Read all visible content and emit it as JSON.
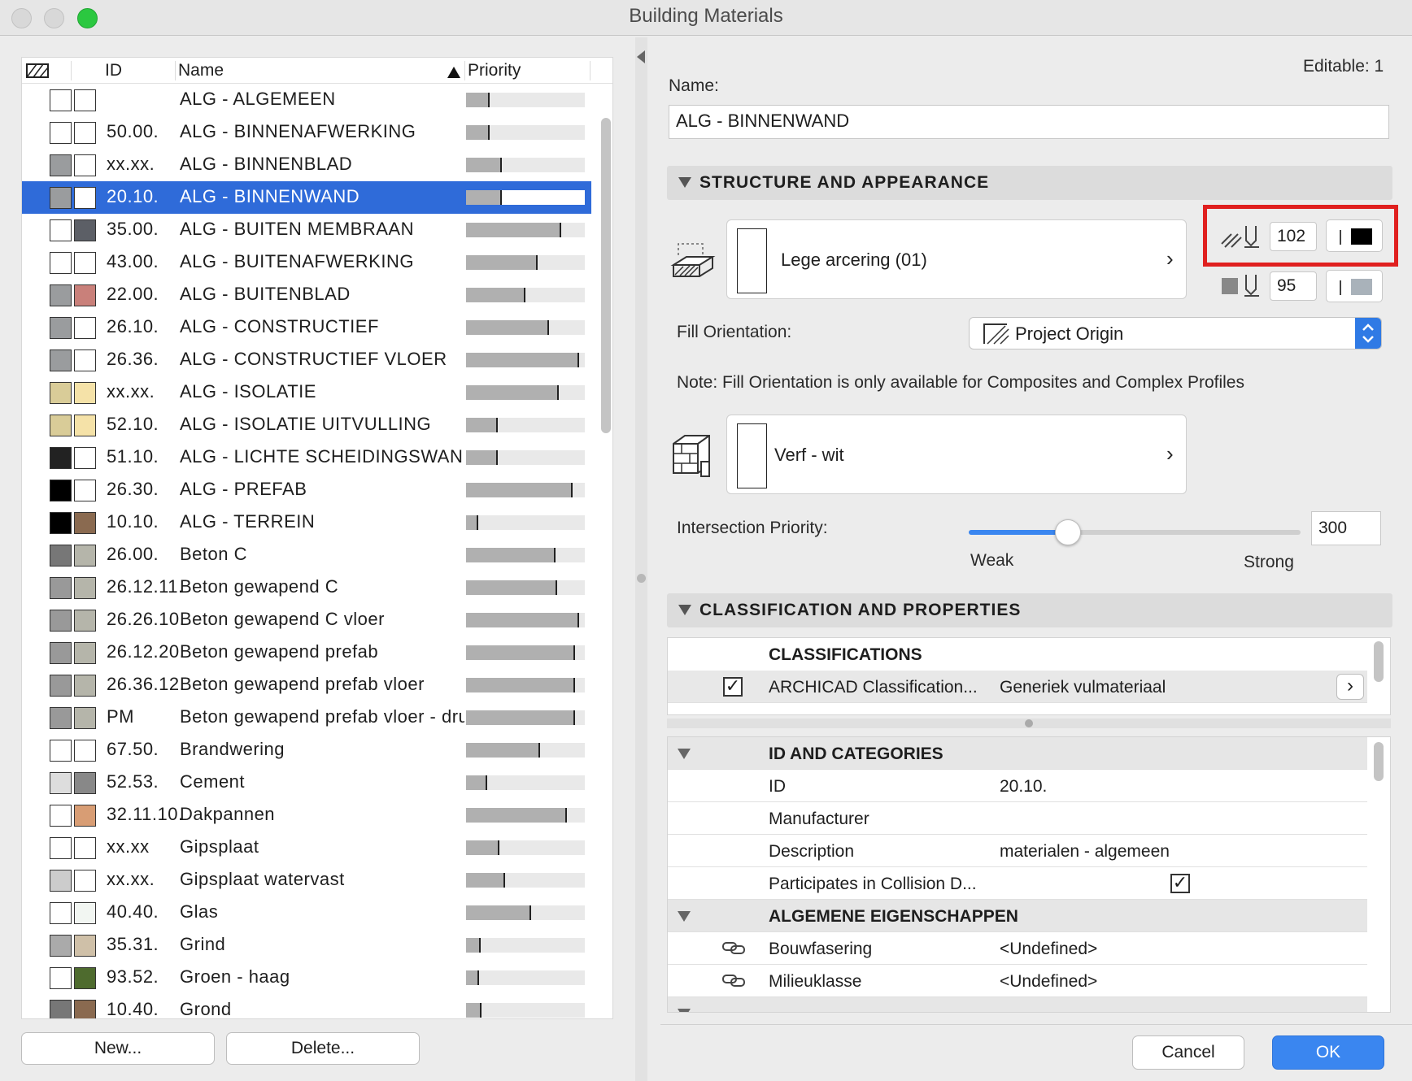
{
  "window": {
    "title": "Building Materials"
  },
  "list": {
    "columns": {
      "id": "ID",
      "name": "Name",
      "priority": "Priority"
    },
    "rows": [
      {
        "id": "",
        "name": "ALG - ALGEMEEN",
        "priority": 0.2,
        "fill": "#ffffff",
        "color": "#ffffff"
      },
      {
        "id": "50.00.",
        "name": "ALG - BINNENAFWERKING",
        "priority": 0.2,
        "fill": "#ffffff",
        "color": "#ffffff"
      },
      {
        "id": "xx.xx.",
        "name": "ALG - BINNENBLAD",
        "priority": 0.3,
        "fill": "#9a9c9e",
        "color": "#ffffff"
      },
      {
        "id": "20.10.",
        "name": "ALG - BINNENWAND",
        "priority": 0.3,
        "fill": "#9a9c9e",
        "color": "#ffffff",
        "selected": true
      },
      {
        "id": "35.00.",
        "name": "ALG - BUITEN MEMBRAAN",
        "priority": 0.8,
        "fill": "#ffffff",
        "color": "#5c5f66"
      },
      {
        "id": "43.00.",
        "name": "ALG - BUITENAFWERKING",
        "priority": 0.6,
        "fill": "#ffffff",
        "color": "#ffffff"
      },
      {
        "id": "22.00.",
        "name": "ALG - BUITENBLAD",
        "priority": 0.5,
        "fill": "#9a9c9e",
        "color": "#c9807a"
      },
      {
        "id": "26.10.",
        "name": "ALG - CONSTRUCTIEF",
        "priority": 0.7,
        "fill": "#9a9c9e",
        "color": "#ffffff"
      },
      {
        "id": "26.36.",
        "name": "ALG - CONSTRUCTIEF VLOER",
        "priority": 0.95,
        "fill": "#9a9c9e",
        "color": "#ffffff"
      },
      {
        "id": "xx.xx.",
        "name": "ALG - ISOLATIE",
        "priority": 0.78,
        "fill": "#d9cc98",
        "color": "#f5e2a8"
      },
      {
        "id": "52.10.",
        "name": "ALG - ISOLATIE UITVULLING",
        "priority": 0.27,
        "fill": "#d9cc98",
        "color": "#f5e2a8"
      },
      {
        "id": "51.10.",
        "name": "ALG - LICHTE SCHEIDINGSWAND",
        "priority": 0.27,
        "fill": "#222222",
        "color": "#ffffff"
      },
      {
        "id": "26.30.",
        "name": "ALG - PREFAB",
        "priority": 0.9,
        "fill": "#000000",
        "color": "#ffffff"
      },
      {
        "id": "10.10.",
        "name": "ALG - TERREIN",
        "priority": 0.1,
        "fill": "#000000",
        "color": "#8a6a50"
      },
      {
        "id": "26.00.",
        "name": "Beton C",
        "priority": 0.75,
        "fill": "#777777",
        "color": "#b5b5aa"
      },
      {
        "id": "26.12.11.",
        "name": "Beton gewapend C",
        "priority": 0.77,
        "fill": "#999999",
        "color": "#b5b5aa"
      },
      {
        "id": "26.26.10.",
        "name": "Beton gewapend C vloer",
        "priority": 0.95,
        "fill": "#999999",
        "color": "#b5b5aa"
      },
      {
        "id": "26.12.20.",
        "name": "Beton gewapend prefab",
        "priority": 0.92,
        "fill": "#999999",
        "color": "#b5b5aa"
      },
      {
        "id": "26.36.12.",
        "name": "Beton gewapend prefab vloer",
        "priority": 0.92,
        "fill": "#999999",
        "color": "#b5b5aa"
      },
      {
        "id": "PM",
        "name": "Beton gewapend prefab vloer - druklaag",
        "priority": 0.92,
        "fill": "#999999",
        "color": "#b5b5aa"
      },
      {
        "id": "67.50.",
        "name": "Brandwering",
        "priority": 0.62,
        "fill": "#ffffff",
        "color": "#ffffff"
      },
      {
        "id": "52.53.",
        "name": "Cement",
        "priority": 0.18,
        "fill": "#dddddd",
        "color": "#888888"
      },
      {
        "id": "32.11.10.",
        "name": "Dakpannen",
        "priority": 0.85,
        "fill": "#ffffff",
        "color": "#d89d74"
      },
      {
        "id": "xx.xx",
        "name": "Gipsplaat",
        "priority": 0.28,
        "fill": "#ffffff",
        "color": "#ffffff"
      },
      {
        "id": "xx.xx.",
        "name": "Gipsplaat watervast",
        "priority": 0.33,
        "fill": "#cccccc",
        "color": "#ffffff"
      },
      {
        "id": "40.40.",
        "name": "Glas",
        "priority": 0.55,
        "fill": "#ffffff",
        "color": "#f2f6f2"
      },
      {
        "id": "35.31.",
        "name": "Grind",
        "priority": 0.12,
        "fill": "#aaaaaa",
        "color": "#cfc0a8"
      },
      {
        "id": "93.52.",
        "name": "Groen - haag",
        "priority": 0.11,
        "fill": "#ffffff",
        "color": "#4e6b2e"
      },
      {
        "id": "10.40.",
        "name": "Grond",
        "priority": 0.13,
        "fill": "#777777",
        "color": "#8a6a50"
      }
    ],
    "new_label": "New...",
    "delete_label": "Delete..."
  },
  "detail": {
    "editable": "Editable: 1",
    "name_label": "Name:",
    "name_value": "ALG - BINNENWAND",
    "structure_title": "STRUCTURE AND APPEARANCE",
    "cut_fill": "Lege arcering (01)",
    "pen_fg": "102",
    "pen_bg": "95",
    "fill_orientation_label": "Fill Orientation:",
    "fill_orientation_value": "Project Origin",
    "note": "Note: Fill Orientation is only available for Composites and Complex Profiles",
    "surface": "Verf - wit",
    "intersection_label": "Intersection Priority:",
    "intersection_value": "300",
    "intersection_fraction": 0.3,
    "weak": "Weak",
    "strong": "Strong",
    "classification_title": "CLASSIFICATION AND PROPERTIES",
    "classifications_header": "CLASSIFICATIONS",
    "classification_name": "ARCHICAD Classification...",
    "classification_value": "Generiek vulmateriaal",
    "id_header": "ID AND CATEGORIES",
    "props": {
      "id_k": "ID",
      "id_v": "20.10.",
      "manufacturer_k": "Manufacturer",
      "description_k": "Description",
      "description_v": "materialen - algemeen",
      "collision_k": "Participates in Collision D..."
    },
    "general_header": "ALGEMENE EIGENSCHAPPEN",
    "bouw_k": "Bouwfasering",
    "bouw_v": "<Undefined>",
    "milieu_k": "Milieuklasse",
    "milieu_v": "<Undefined>"
  },
  "buttons": {
    "cancel": "Cancel",
    "ok": "OK"
  },
  "colors": {
    "accent": "#2f6bd9",
    "highlight_box": "#e0201f",
    "ok_button": "#3a86f0"
  }
}
